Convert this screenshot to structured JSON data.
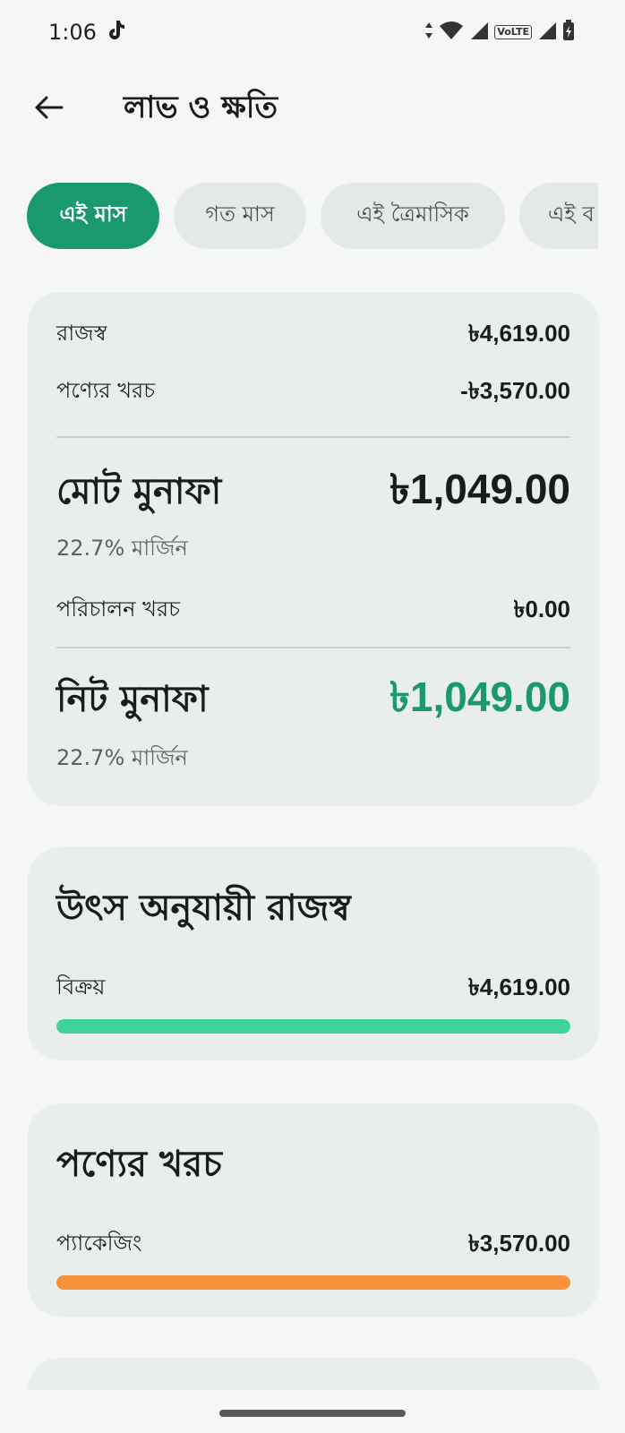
{
  "status_bar": {
    "time": "1:06",
    "volte": "VoLTE"
  },
  "header": {
    "title": "লাভ ও ক্ষতি"
  },
  "filters": {
    "chips": [
      {
        "label": "এই মাস",
        "active": true
      },
      {
        "label": "গত মাস",
        "active": false
      },
      {
        "label": "এই ত্রৈমাসিক",
        "active": false
      },
      {
        "label": "এই ব",
        "active": false
      }
    ]
  },
  "summary": {
    "revenue_label": "রাজস্ব",
    "revenue_value": "৳4,619.00",
    "cogs_label": "পণ্যের খরচ",
    "cogs_value": "-৳3,570.00",
    "gross_profit_label": "মোট মুনাফা",
    "gross_profit_value": "৳1,049.00",
    "gross_margin": "22.7% মার্জিন",
    "opex_label": "পরিচালন খরচ",
    "opex_value": "৳0.00",
    "net_profit_label": "নিট মুনাফা",
    "net_profit_value": "৳1,049.00",
    "net_margin": "22.7% মার্জিন"
  },
  "revenue_by_source": {
    "title": "উৎস অনুযায়ী রাজস্ব",
    "items": [
      {
        "label": "বিক্রয়",
        "value": "৳4,619.00",
        "share": 1.0,
        "color": "#3dd39a"
      }
    ]
  },
  "product_cost": {
    "title": "পণ্যের খরচ",
    "items": [
      {
        "label": "প্যাকেজিং",
        "value": "৳3,570.00",
        "share": 1.0,
        "color": "#f7923a"
      }
    ]
  },
  "colors": {
    "accent": "#1a9a6c",
    "background": "#f4f7f5",
    "card": "#e9eeeb"
  }
}
